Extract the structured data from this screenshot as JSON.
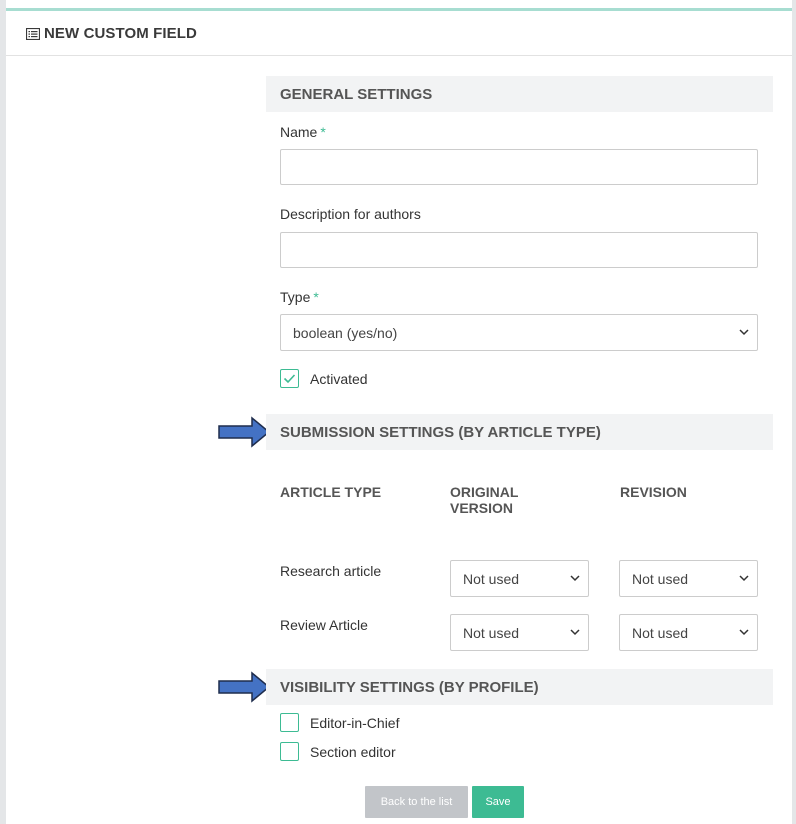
{
  "header": {
    "title": "NEW CUSTOM FIELD",
    "icon": "list-icon"
  },
  "general": {
    "heading": "GENERAL SETTINGS",
    "name_label": "Name",
    "name_value": "",
    "description_label": "Description for authors",
    "description_value": "",
    "type_label": "Type",
    "type_value": "boolean (yes/no)",
    "required_mark": "*",
    "activated_label": "Activated",
    "activated_checked": true
  },
  "submission": {
    "heading": "SUBMISSION SETTINGS (BY ARTICLE TYPE)",
    "columns": [
      "ARTICLE TYPE",
      "ORIGINAL VERSION",
      "REVISION"
    ],
    "rows": [
      {
        "label": "Research article",
        "original": "Not used",
        "revision": "Not used"
      },
      {
        "label": "Review Article",
        "original": "Not used",
        "revision": "Not used"
      }
    ]
  },
  "visibility": {
    "heading": "VISIBILITY SETTINGS (BY PROFILE)",
    "profiles": [
      {
        "label": "Editor-in-Chief",
        "checked": false
      },
      {
        "label": "Section editor",
        "checked": false
      }
    ]
  },
  "buttons": {
    "back": "Back to the list",
    "save": "Save"
  },
  "colors": {
    "accent": "#3dbb93",
    "arrow_fill": "#4472c4",
    "arrow_stroke": "#1f2d4d",
    "section_bg": "#f2f3f4"
  }
}
